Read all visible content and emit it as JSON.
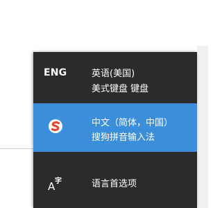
{
  "language_flyout": {
    "languages": [
      {
        "code": "ENG",
        "name": "英语(美国)",
        "keyboard": "美式键盘 键盘",
        "selected": false
      },
      {
        "code": "",
        "icon": "sogou-pinyin-icon",
        "name": "中文（简体，中国）",
        "keyboard": "搜狗拼音输入法",
        "selected": true
      }
    ],
    "preferences": {
      "icon": "language-preferences-icon",
      "glyph_small": "字",
      "glyph_big": "A",
      "label": "语言首选项"
    }
  },
  "colors": {
    "flyout_bg": "#2b2b2b",
    "selected_bg": "#3b8ed9",
    "sogou_red": "#e8402b",
    "text": "#ffffff"
  }
}
